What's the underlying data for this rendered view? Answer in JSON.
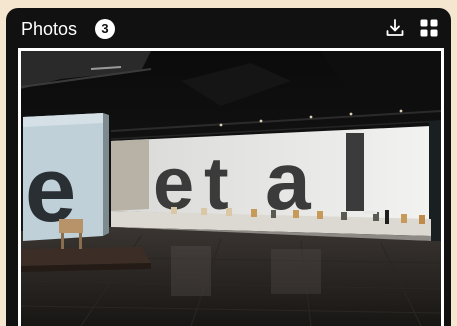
{
  "header": {
    "title": "Photos",
    "count": "3"
  },
  "icons": {
    "download": "download-icon",
    "grid": "grid-view-icon"
  },
  "photo": {
    "letters": [
      "e",
      "e",
      "t",
      "a",
      "l"
    ]
  },
  "colors": {
    "card_background": "#111111",
    "page_background": "#f5e6cf",
    "badge_background": "#ffffff"
  }
}
